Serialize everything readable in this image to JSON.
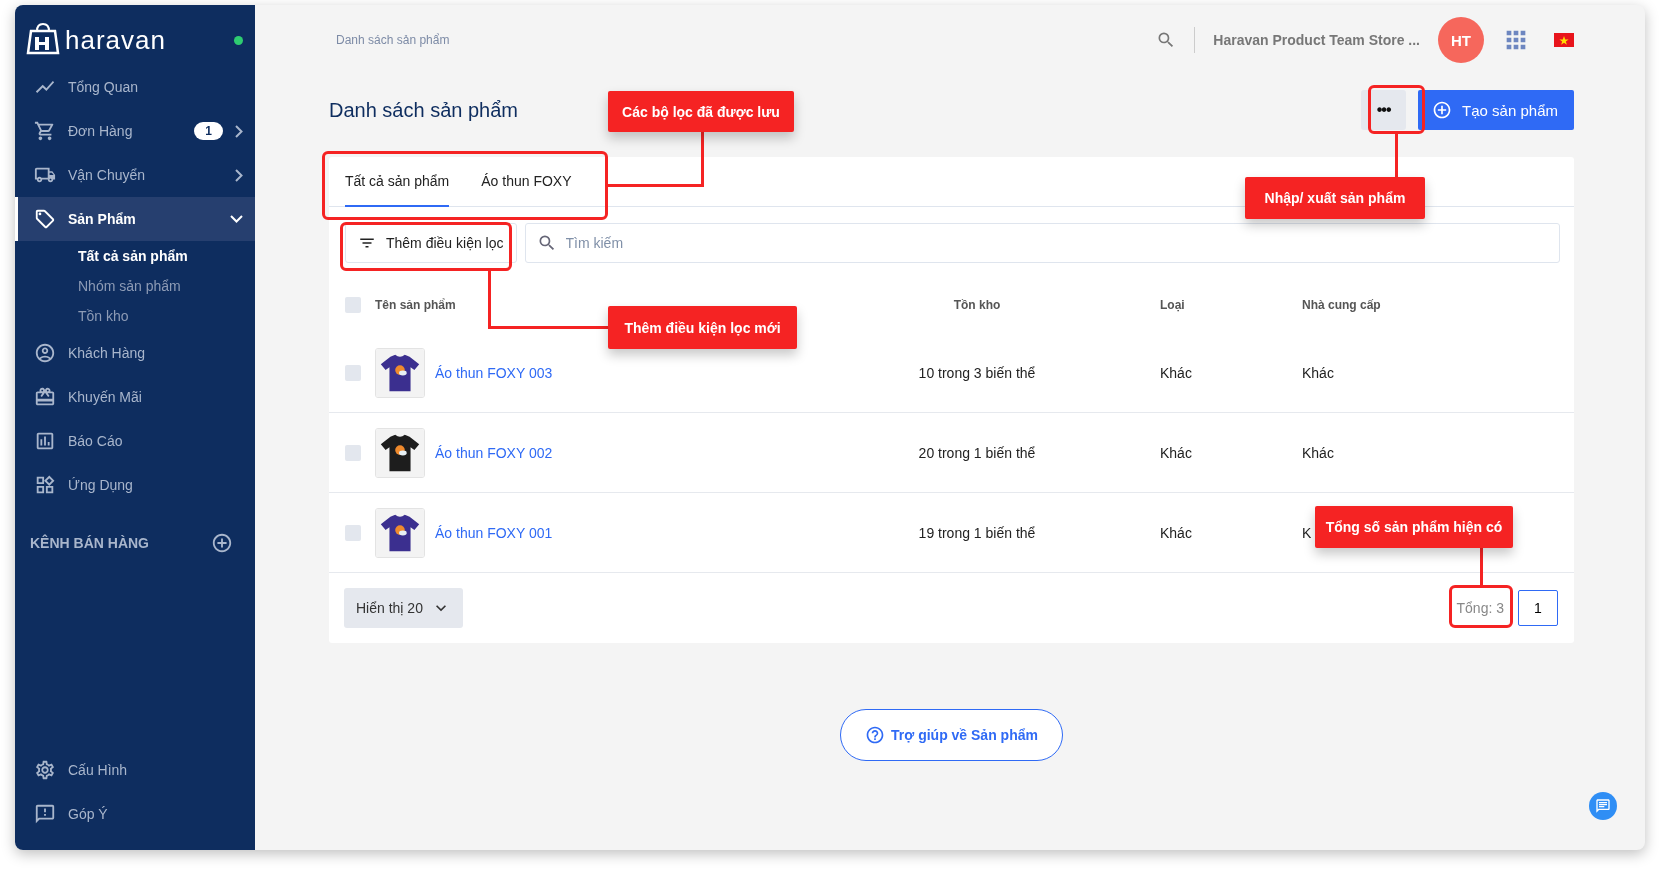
{
  "sidebar": {
    "brand": "haravan",
    "online": true,
    "items": [
      {
        "label": "Tổng Quan",
        "selected": false
      },
      {
        "label": "Đơn Hàng",
        "badge": "1",
        "expanded": false,
        "selected": false
      },
      {
        "label": "Vận Chuyển",
        "expanded": false,
        "selected": false
      },
      {
        "label": "Sản Phẩm",
        "expanded": true,
        "selected": true,
        "children": [
          {
            "label": "Tất cả sản phẩm",
            "selected": true
          },
          {
            "label": "Nhóm sản phẩm",
            "selected": false
          },
          {
            "label": "Tồn kho",
            "selected": false
          }
        ]
      },
      {
        "label": "Khách Hàng",
        "selected": false
      },
      {
        "label": "Khuyến Mãi",
        "selected": false
      },
      {
        "label": "Báo Cáo",
        "selected": false
      },
      {
        "label": "Ứng Dụng",
        "selected": false
      }
    ],
    "section": "KÊNH BÁN HÀNG",
    "bottom_items": [
      {
        "label": "Cấu Hình",
        "selected": false
      },
      {
        "label": "Góp Ý",
        "selected": false
      }
    ]
  },
  "topbar": {
    "breadcrumb": "Danh sách sản phẩm",
    "store": "Haravan Product Team Store ...",
    "avatar": "HT"
  },
  "page": {
    "title": "Danh sách sản phẩm",
    "more_button": "•••",
    "create_button": "Tạo sản phẩm"
  },
  "tabs": [
    {
      "label": "Tất cả sản phẩm",
      "selected": true
    },
    {
      "label": "Áo thun FOXY",
      "selected": false
    }
  ],
  "filter": {
    "button": "Thêm điều kiện lọc",
    "placeholder": "Tìm kiếm"
  },
  "table": {
    "all_checked": false,
    "columns": [
      "Tên sản phẩm",
      "Tồn kho",
      "Loại",
      "Nhà cung cấp"
    ],
    "rows": [
      {
        "name": "Áo thun FOXY 003",
        "stock": "10 trong 3 biến thể",
        "type": "Khác",
        "supplier": "Khác",
        "checked": false
      },
      {
        "name": "Áo thun FOXY 002",
        "stock": "20 trong 1 biến thể",
        "type": "Khác",
        "supplier": "Khác",
        "checked": false
      },
      {
        "name": "Áo thun FOXY 001",
        "stock": "19 trong 1 biến thể",
        "type": "Khác",
        "supplier": "K",
        "checked": false
      }
    ]
  },
  "footer": {
    "page_size": "Hiển thị 20",
    "total": "Tổng: 3",
    "pages": [
      {
        "label": "1",
        "selected": true
      }
    ]
  },
  "help_button": "Trợ giúp về Sản phẩm",
  "annotations": [
    "Các bộ lọc đã được lưu",
    "Thêm điều kiện lọc mới",
    "Nhập/ xuất sản phẩm",
    "Tổng số sản phẩm hiện có"
  ]
}
